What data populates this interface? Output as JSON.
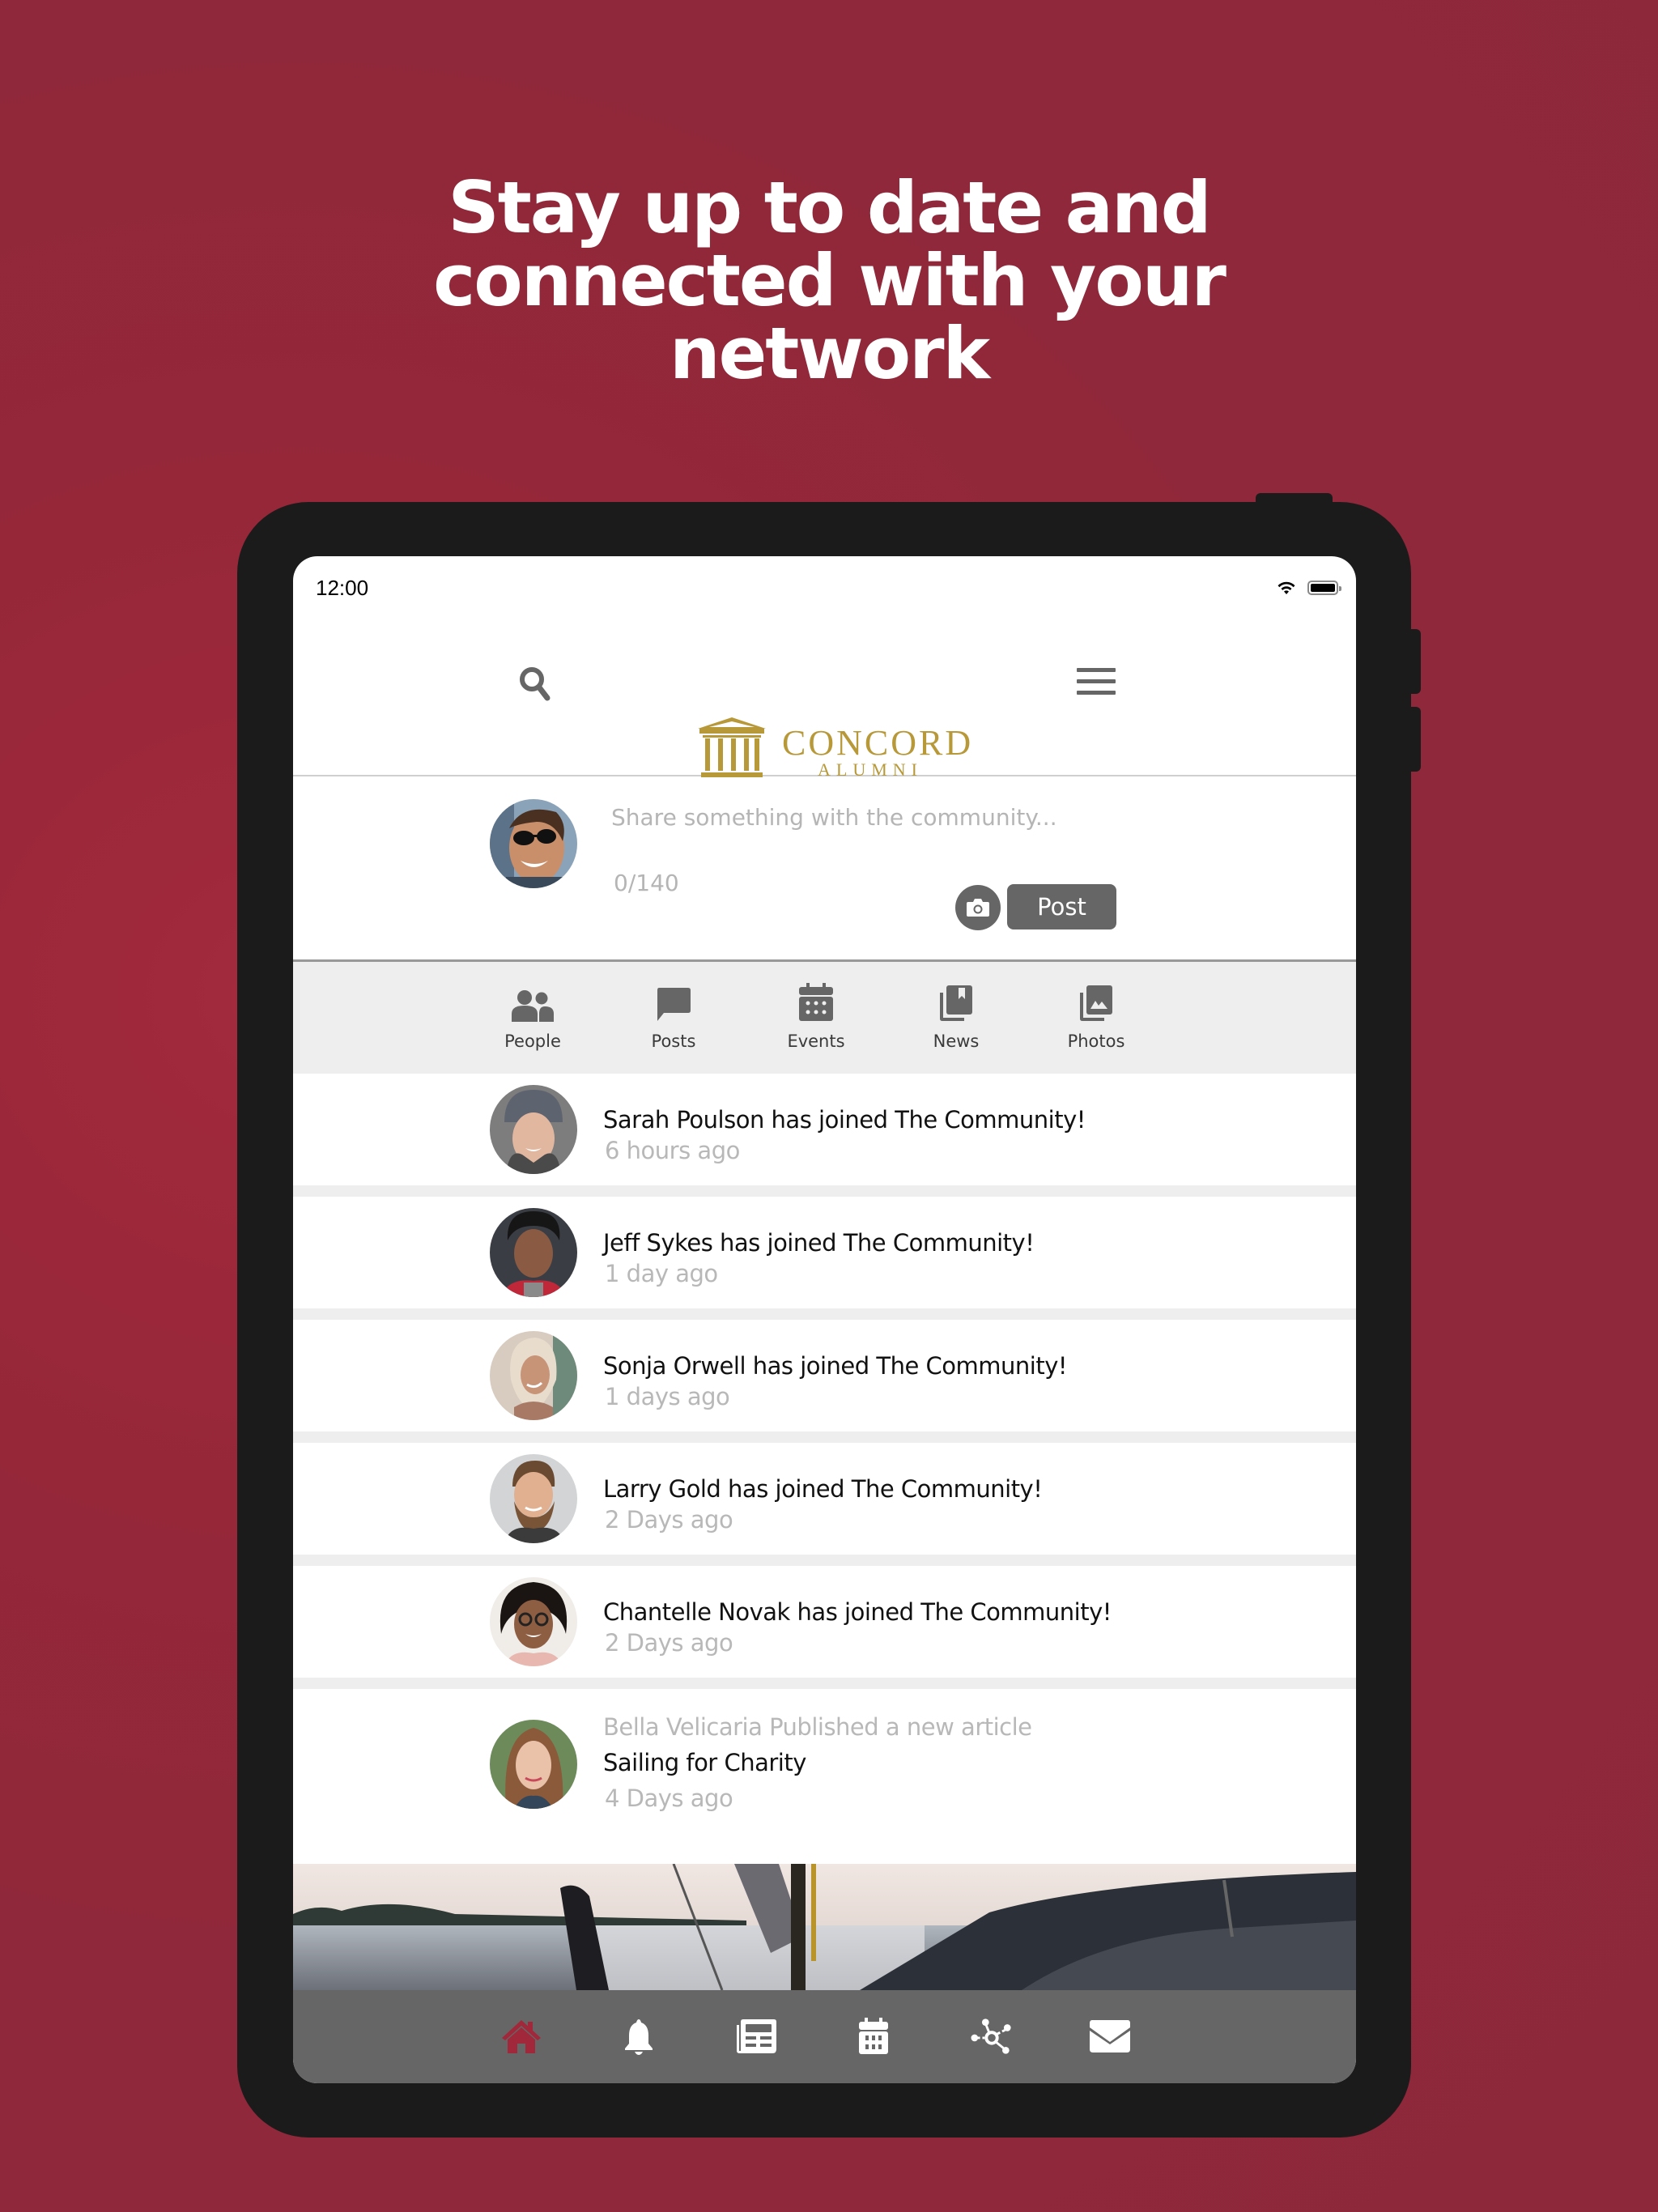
{
  "headline": {
    "lines": [
      "Stay up to date and",
      "connected with your",
      "network"
    ]
  },
  "colors": {
    "background": "#8e283a",
    "brand_gold": "#b8993a",
    "active_nav": "#a0283a",
    "nav_bg": "#666666",
    "icon_gray": "#666666"
  },
  "status_bar": {
    "time": "12:00",
    "icons": [
      "wifi-icon",
      "battery-icon"
    ]
  },
  "header": {
    "logo_word": "CONCORD",
    "logo_sub": "ALUMNI",
    "left_icon": "search-icon",
    "right_icon": "menu-icon"
  },
  "composer": {
    "placeholder": "Share something with the community...",
    "counter": "0/140",
    "camera_icon": "camera-icon",
    "post_label": "Post"
  },
  "tabs": [
    {
      "label": "People",
      "icon": "people-icon"
    },
    {
      "label": "Posts",
      "icon": "chat-bubble-icon"
    },
    {
      "label": "Events",
      "icon": "calendar-icon"
    },
    {
      "label": "News",
      "icon": "news-icon"
    },
    {
      "label": "Photos",
      "icon": "photos-icon"
    }
  ],
  "feed": [
    {
      "title": "Sarah Poulson has joined The Community!",
      "time": "6 hours ago"
    },
    {
      "title": "Jeff Sykes has joined The Community!",
      "time": "1 day ago"
    },
    {
      "title": "Sonja Orwell has joined The Community!",
      "time": "1 days ago"
    },
    {
      "title": "Larry Gold has joined The Community!",
      "time": "2 Days ago"
    },
    {
      "title": "Chantelle Novak has joined The Community!",
      "time": "2 Days ago"
    }
  ],
  "article": {
    "meta": "Bella Velicaria Published a new article",
    "title": "Sailing for Charity",
    "time": "4 Days ago"
  },
  "bottom_nav": [
    {
      "icon": "home-icon",
      "active": true
    },
    {
      "icon": "bell-icon",
      "active": false
    },
    {
      "icon": "newspaper-icon",
      "active": false
    },
    {
      "icon": "calendar-icon",
      "active": false
    },
    {
      "icon": "network-icon",
      "active": false
    },
    {
      "icon": "mail-icon",
      "active": false
    }
  ]
}
